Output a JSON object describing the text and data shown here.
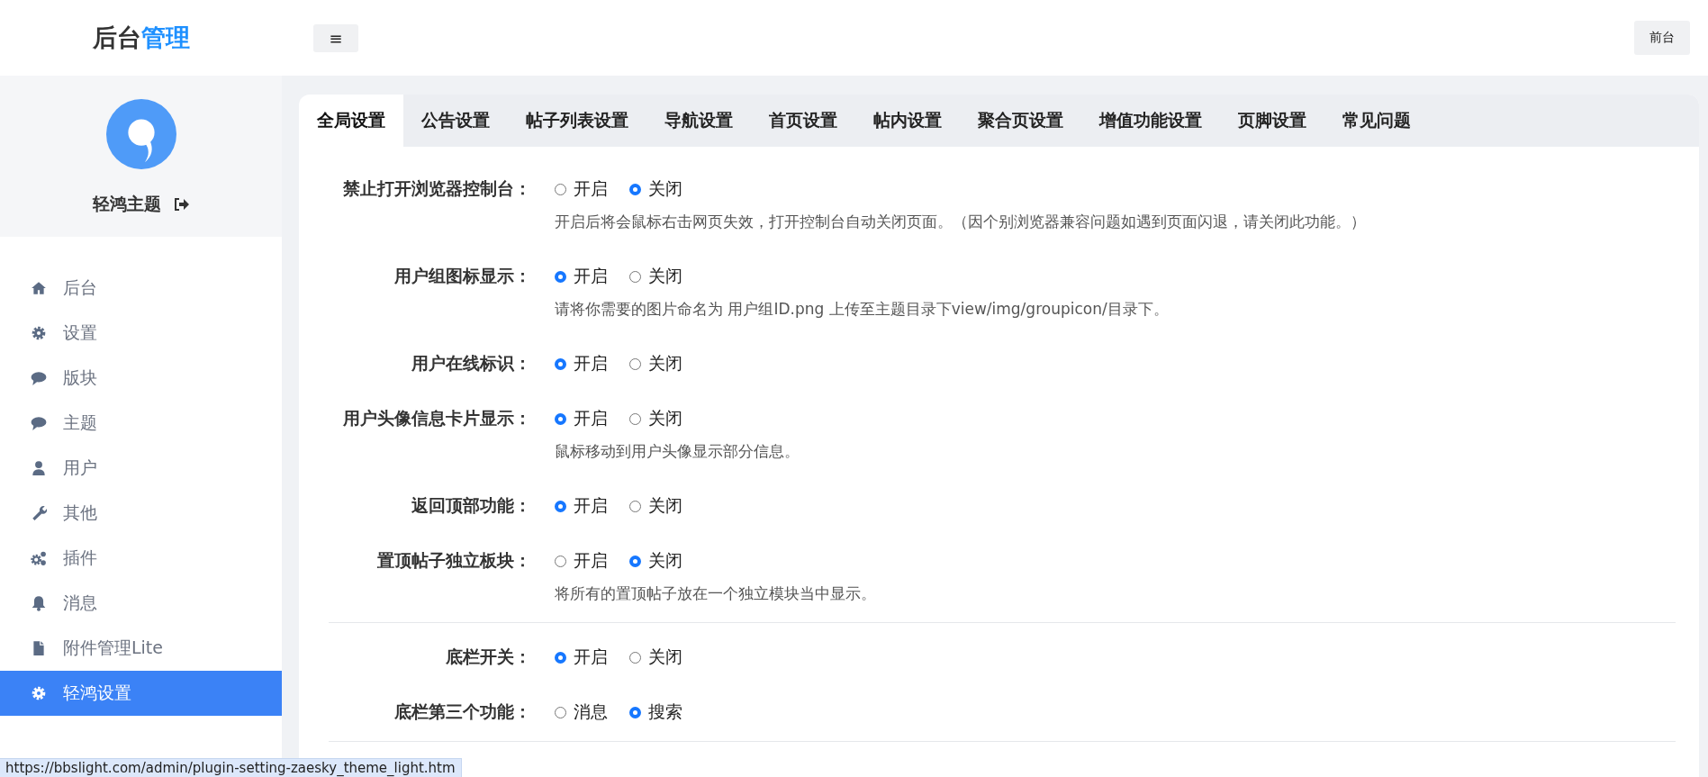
{
  "header": {
    "logo": {
      "dark": "后台",
      "accent": "管理"
    },
    "menu_button": "≡",
    "front_button": "前台"
  },
  "sidebar": {
    "profile": {
      "name": "轻鸿主题"
    },
    "items": [
      {
        "label": "后台",
        "selected": false
      },
      {
        "label": "设置",
        "selected": false
      },
      {
        "label": "版块",
        "selected": false
      },
      {
        "label": "主题",
        "selected": false
      },
      {
        "label": "用户",
        "selected": false
      },
      {
        "label": "其他",
        "selected": false
      },
      {
        "label": "插件",
        "selected": false
      },
      {
        "label": "消息",
        "selected": false
      },
      {
        "label": "附件管理Lite",
        "selected": false
      },
      {
        "label": "轻鸿设置",
        "selected": true
      }
    ]
  },
  "tabs": [
    {
      "label": "全局设置",
      "selected": true
    },
    {
      "label": "公告设置",
      "selected": false
    },
    {
      "label": "帖子列表设置",
      "selected": false
    },
    {
      "label": "导航设置",
      "selected": false
    },
    {
      "label": "首页设置",
      "selected": false
    },
    {
      "label": "帖内设置",
      "selected": false
    },
    {
      "label": "聚合页设置",
      "selected": false
    },
    {
      "label": "增值功能设置",
      "selected": false
    },
    {
      "label": "页脚设置",
      "selected": false
    },
    {
      "label": "常见问题",
      "selected": false
    }
  ],
  "sections": [
    {
      "settings": [
        {
          "label": "禁止打开浏览器控制台：",
          "options": [
            {
              "label": "开启",
              "selected": false
            },
            {
              "label": "关闭",
              "selected": true
            }
          ],
          "help": "开启后将会鼠标右击网页失效，打开控制台自动关闭页面。（因个别浏览器兼容问题如遇到页面闪退，请关闭此功能。）"
        },
        {
          "label": "用户组图标显示：",
          "options": [
            {
              "label": "开启",
              "selected": true
            },
            {
              "label": "关闭",
              "selected": false
            }
          ],
          "help": "请将你需要的图片命名为 用户组ID.png 上传至主题目录下view/img/groupicon/目录下。"
        },
        {
          "label": "用户在线标识：",
          "options": [
            {
              "label": "开启",
              "selected": true
            },
            {
              "label": "关闭",
              "selected": false
            }
          ]
        },
        {
          "label": "用户头像信息卡片显示：",
          "options": [
            {
              "label": "开启",
              "selected": true
            },
            {
              "label": "关闭",
              "selected": false
            }
          ],
          "help": "鼠标移动到用户头像显示部分信息。"
        },
        {
          "label": "返回顶部功能：",
          "options": [
            {
              "label": "开启",
              "selected": true
            },
            {
              "label": "关闭",
              "selected": false
            }
          ]
        },
        {
          "label": "置顶帖子独立板块：",
          "options": [
            {
              "label": "开启",
              "selected": false
            },
            {
              "label": "关闭",
              "selected": true
            }
          ],
          "help": "将所有的置顶帖子放在一个独立模块当中显示。"
        }
      ]
    },
    {
      "settings": [
        {
          "label": "底栏开关：",
          "options": [
            {
              "label": "开启",
              "selected": true
            },
            {
              "label": "关闭",
              "selected": false
            }
          ]
        },
        {
          "label": "底栏第三个功能：",
          "options": [
            {
              "label": "消息",
              "selected": false
            },
            {
              "label": "搜索",
              "selected": true
            }
          ]
        }
      ]
    }
  ],
  "status_bar": {
    "url": "https://bbslight.com/admin/plugin-setting-zaesky_theme_light.htm"
  }
}
